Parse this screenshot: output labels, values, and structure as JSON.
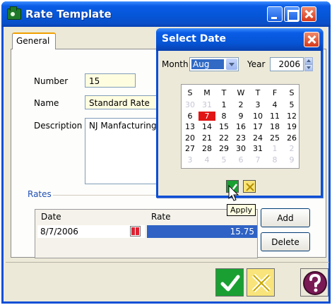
{
  "window": {
    "title": "Rate Template"
  },
  "tabs": [
    {
      "label": "General"
    }
  ],
  "form": {
    "number_label": "Number",
    "number_value": "15",
    "name_label": "Name",
    "name_value": "Standard Rate",
    "description_label": "Description",
    "description_value": "NJ Manfacturing"
  },
  "rates": {
    "section_label": "Rates",
    "columns": [
      "Date",
      "Rate"
    ],
    "rows": [
      {
        "date": "8/7/2006",
        "rate": "15.75"
      }
    ],
    "add_label": "Add",
    "delete_label": "Delete"
  },
  "date_popup": {
    "title": "Select Date",
    "month_label": "Month",
    "month_value": "Aug",
    "year_label": "Year",
    "year_value": "2006",
    "weekdays": [
      "S",
      "M",
      "T",
      "W",
      "T",
      "F",
      "S"
    ],
    "weeks": [
      [
        "30",
        "31",
        "1",
        "2",
        "3",
        "4",
        "5"
      ],
      [
        "6",
        "7",
        "8",
        "9",
        "10",
        "11",
        "12"
      ],
      [
        "13",
        "14",
        "15",
        "16",
        "17",
        "18",
        "19"
      ],
      [
        "20",
        "21",
        "22",
        "23",
        "24",
        "25",
        "26"
      ],
      [
        "27",
        "28",
        "29",
        "30",
        "31",
        "1",
        "2"
      ],
      [
        "3",
        "4",
        "5",
        "6",
        "7",
        "8",
        "9"
      ]
    ],
    "dim_cells": [
      [
        0,
        0
      ],
      [
        0,
        1
      ],
      [
        4,
        5
      ],
      [
        4,
        6
      ],
      [
        5,
        0
      ],
      [
        5,
        1
      ],
      [
        5,
        2
      ],
      [
        5,
        3
      ],
      [
        5,
        4
      ],
      [
        5,
        5
      ],
      [
        5,
        6
      ]
    ],
    "selected_cell": [
      1,
      1
    ],
    "apply_tooltip": "Apply"
  },
  "colors": {
    "title_blue": "#0655d6",
    "selection_blue": "#2f62c4",
    "selected_day_red": "#e11515",
    "ok_green": "#1aa032",
    "cancel_yellow": "#f8e47a",
    "rates_label_blue": "#1f4fb5"
  },
  "icons": {
    "app": "green-briefcase-icon",
    "ok": "checkmark-icon",
    "cancel": "x-icon",
    "help": "question-mark-icon",
    "calendar_small": "calendar-icon"
  }
}
